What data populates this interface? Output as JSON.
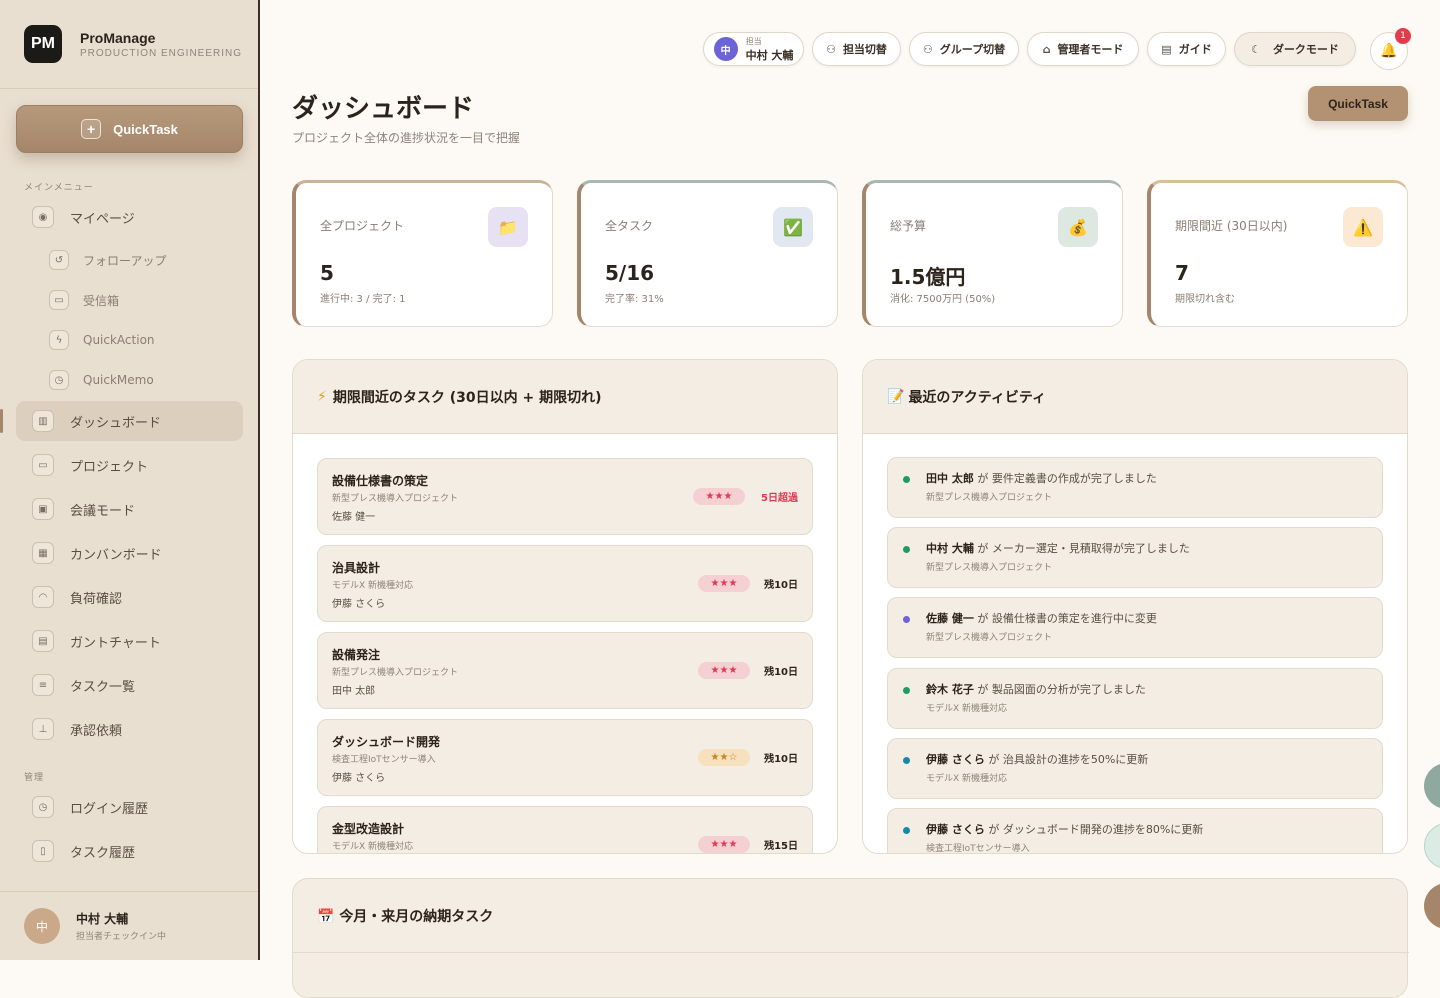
{
  "brand": {
    "logo": "PM",
    "name": "ProManage",
    "sub": "PRODUCTION ENGINEERING"
  },
  "sidebar": {
    "quicktask": "QuickTask",
    "main_label": "メインメニュー",
    "admin_label": "管理",
    "items": [
      {
        "label": "マイページ",
        "icon": "person-icon"
      },
      {
        "label": "フォローアップ",
        "icon": "followup-icon"
      },
      {
        "label": "受信箱",
        "icon": "inbox-icon"
      },
      {
        "label": "QuickAction",
        "icon": "bolt-icon"
      },
      {
        "label": "QuickMemo",
        "icon": "clock-icon"
      },
      {
        "label": "ダッシュボード",
        "icon": "chart-icon"
      },
      {
        "label": "プロジェクト",
        "icon": "folder-icon"
      },
      {
        "label": "会議モード",
        "icon": "meeting-icon"
      },
      {
        "label": "カンバンボード",
        "icon": "kanban-icon"
      },
      {
        "label": "負荷確認",
        "icon": "gauge-icon"
      },
      {
        "label": "ガントチャート",
        "icon": "calendar-icon"
      },
      {
        "label": "タスク一覧",
        "icon": "list-icon"
      },
      {
        "label": "承認依頼",
        "icon": "approval-icon"
      }
    ],
    "admin_items": [
      {
        "label": "ログイン履歴",
        "icon": "clock-icon"
      },
      {
        "label": "タスク履歴",
        "icon": "document-icon"
      }
    ],
    "user": {
      "avatar": "中",
      "name": "中村 大輔",
      "sub": "担当者チェックイン中"
    }
  },
  "topbar": {
    "assignee_small": "担当",
    "assignee_name": "中村 大輔",
    "assignee_avatar": "中",
    "switch_assignee": "担当切替",
    "switch_group": "グループ切替",
    "admin_mode": "管理者モード",
    "guide": "ガイド",
    "dark_mode": "ダークモード",
    "notifications": "1",
    "quicktask": "QuickTask"
  },
  "page": {
    "title": "ダッシュボード",
    "subtitle": "プロジェクト全体の進捗状況を一目で把握"
  },
  "stats": [
    {
      "label": "全プロジェクト",
      "value": "5",
      "sub": "進行中: 3 / 完了: 1",
      "icon": "folder-icon",
      "icon_glyph": "📁",
      "bg": "#e6e1f3"
    },
    {
      "label": "全タスク",
      "value": "5/16",
      "sub": "完了率: 31%",
      "icon": "check-icon",
      "icon_glyph": "✅",
      "bg": "#e1e8f1"
    },
    {
      "label": "総予算",
      "value": "1.5億円",
      "sub": "消化: 7500万円 (50%)",
      "icon": "moneybag-icon",
      "icon_glyph": "💰",
      "bg": "#dde9e0"
    },
    {
      "label": "期限間近 (30日以内)",
      "value": "7",
      "sub": "期限切れ含む",
      "icon": "warning-icon",
      "icon_glyph": "⚠️",
      "bg": "#fbe9d3"
    }
  ],
  "tasks_panel": {
    "title": "期限間近のタスク (30日以内 + 期限切れ)",
    "icon": "⚡",
    "tasks": [
      {
        "title": "設備仕様書の策定",
        "project": "新型プレス機導入プロジェクト",
        "owner": "佐藤 健一",
        "stars": "★★★",
        "due": "5日超過"
      },
      {
        "title": "治具設計",
        "project": "モデルX 新機種対応",
        "owner": "伊藤 さくら",
        "stars": "★★★",
        "due": "残10日"
      },
      {
        "title": "設備発注",
        "project": "新型プレス機導入プロジェクト",
        "owner": "田中 太郎",
        "stars": "★★★",
        "due": "残10日"
      },
      {
        "title": "ダッシュボード開発",
        "project": "検査工程IoTセンサー導入",
        "owner": "伊藤 さくら",
        "stars": "★★☆",
        "due": "残10日"
      },
      {
        "title": "金型改造設計",
        "project": "モデルX 新機種対応",
        "owner": "",
        "stars": "★★★",
        "due": "残15日"
      }
    ]
  },
  "activity_panel": {
    "title": "最近のアクティビティ",
    "icon": "📝",
    "verb": "が",
    "items": [
      {
        "user": "田中 太郎",
        "text": "要件定義書の作成が完了しました",
        "project": "新型プレス機導入プロジェクト",
        "color": "#1f9a62"
      },
      {
        "user": "中村 大輔",
        "text": "メーカー選定・見積取得が完了しました",
        "project": "新型プレス機導入プロジェクト",
        "color": "#1f9a62"
      },
      {
        "user": "佐藤 健一",
        "text": "設備仕様書の策定を進行中に変更",
        "project": "新型プレス機導入プロジェクト",
        "color": "#6b63d6"
      },
      {
        "user": "鈴木 花子",
        "text": "製品図面の分析が完了しました",
        "project": "モデルX 新機種対応",
        "color": "#1f9a62"
      },
      {
        "user": "伊藤 さくら",
        "text": "治具設計の進捗を50%に更新",
        "project": "モデルX 新機種対応",
        "color": "#1689a8"
      },
      {
        "user": "伊藤 さくら",
        "text": "ダッシュボード開発の進捗を80%に更新",
        "project": "検査工程IoTセンサー導入",
        "color": "#1689a8"
      }
    ]
  },
  "bottom_panel": {
    "title": "今月・来月の納期タスク",
    "icon": "📅"
  }
}
